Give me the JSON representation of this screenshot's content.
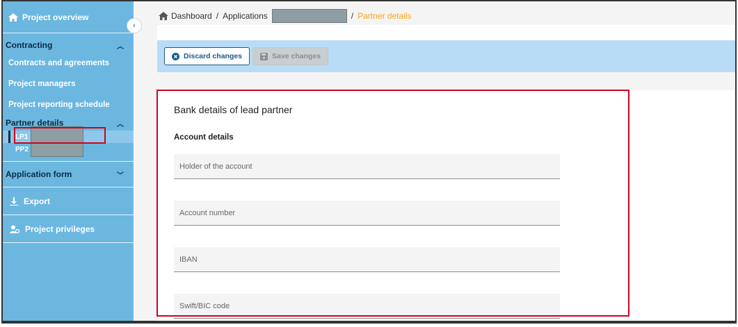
{
  "sidebar": {
    "project_overview": "Project overview",
    "contracting": {
      "heading": "Contracting",
      "items": [
        "Contracts and agreements",
        "Project managers",
        "Project reporting schedule"
      ]
    },
    "partner_details": {
      "heading": "Partner details",
      "items": [
        {
          "label": "LP1",
          "active": true
        },
        {
          "label": "PP2",
          "active": false
        }
      ]
    },
    "application_form": "Application form",
    "export": "Export",
    "project_privileges": "Project privileges"
  },
  "breadcrumb": {
    "dashboard": "Dashboard",
    "applications": "Applications",
    "current": "Partner details"
  },
  "actions": {
    "discard": "Discard changes",
    "save": "Save changes"
  },
  "form": {
    "title": "Bank details of lead partner",
    "section": "Account details",
    "fields": [
      {
        "placeholder": "Holder of the account"
      },
      {
        "placeholder": "Account number"
      },
      {
        "placeholder": "IBAN"
      },
      {
        "placeholder": "Swift/BIC code"
      }
    ]
  },
  "colors": {
    "sidebar": "#6bb7e0",
    "accent": "#1a5a8a",
    "breadcrumb_current": "#f5a623",
    "highlight": "#d0021b"
  }
}
